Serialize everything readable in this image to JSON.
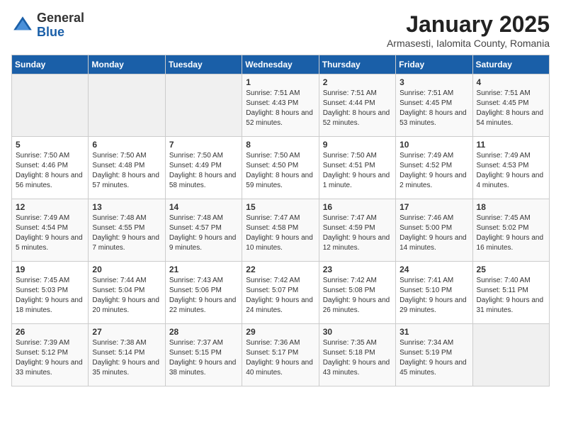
{
  "logo": {
    "general": "General",
    "blue": "Blue"
  },
  "title": "January 2025",
  "subtitle": "Armasesti, Ialomita County, Romania",
  "weekdays": [
    "Sunday",
    "Monday",
    "Tuesday",
    "Wednesday",
    "Thursday",
    "Friday",
    "Saturday"
  ],
  "weeks": [
    [
      {
        "day": "",
        "info": ""
      },
      {
        "day": "",
        "info": ""
      },
      {
        "day": "",
        "info": ""
      },
      {
        "day": "1",
        "info": "Sunrise: 7:51 AM\nSunset: 4:43 PM\nDaylight: 8 hours and 52 minutes."
      },
      {
        "day": "2",
        "info": "Sunrise: 7:51 AM\nSunset: 4:44 PM\nDaylight: 8 hours and 52 minutes."
      },
      {
        "day": "3",
        "info": "Sunrise: 7:51 AM\nSunset: 4:45 PM\nDaylight: 8 hours and 53 minutes."
      },
      {
        "day": "4",
        "info": "Sunrise: 7:51 AM\nSunset: 4:45 PM\nDaylight: 8 hours and 54 minutes."
      }
    ],
    [
      {
        "day": "5",
        "info": "Sunrise: 7:50 AM\nSunset: 4:46 PM\nDaylight: 8 hours and 56 minutes."
      },
      {
        "day": "6",
        "info": "Sunrise: 7:50 AM\nSunset: 4:48 PM\nDaylight: 8 hours and 57 minutes."
      },
      {
        "day": "7",
        "info": "Sunrise: 7:50 AM\nSunset: 4:49 PM\nDaylight: 8 hours and 58 minutes."
      },
      {
        "day": "8",
        "info": "Sunrise: 7:50 AM\nSunset: 4:50 PM\nDaylight: 8 hours and 59 minutes."
      },
      {
        "day": "9",
        "info": "Sunrise: 7:50 AM\nSunset: 4:51 PM\nDaylight: 9 hours and 1 minute."
      },
      {
        "day": "10",
        "info": "Sunrise: 7:49 AM\nSunset: 4:52 PM\nDaylight: 9 hours and 2 minutes."
      },
      {
        "day": "11",
        "info": "Sunrise: 7:49 AM\nSunset: 4:53 PM\nDaylight: 9 hours and 4 minutes."
      }
    ],
    [
      {
        "day": "12",
        "info": "Sunrise: 7:49 AM\nSunset: 4:54 PM\nDaylight: 9 hours and 5 minutes."
      },
      {
        "day": "13",
        "info": "Sunrise: 7:48 AM\nSunset: 4:55 PM\nDaylight: 9 hours and 7 minutes."
      },
      {
        "day": "14",
        "info": "Sunrise: 7:48 AM\nSunset: 4:57 PM\nDaylight: 9 hours and 9 minutes."
      },
      {
        "day": "15",
        "info": "Sunrise: 7:47 AM\nSunset: 4:58 PM\nDaylight: 9 hours and 10 minutes."
      },
      {
        "day": "16",
        "info": "Sunrise: 7:47 AM\nSunset: 4:59 PM\nDaylight: 9 hours and 12 minutes."
      },
      {
        "day": "17",
        "info": "Sunrise: 7:46 AM\nSunset: 5:00 PM\nDaylight: 9 hours and 14 minutes."
      },
      {
        "day": "18",
        "info": "Sunrise: 7:45 AM\nSunset: 5:02 PM\nDaylight: 9 hours and 16 minutes."
      }
    ],
    [
      {
        "day": "19",
        "info": "Sunrise: 7:45 AM\nSunset: 5:03 PM\nDaylight: 9 hours and 18 minutes."
      },
      {
        "day": "20",
        "info": "Sunrise: 7:44 AM\nSunset: 5:04 PM\nDaylight: 9 hours and 20 minutes."
      },
      {
        "day": "21",
        "info": "Sunrise: 7:43 AM\nSunset: 5:06 PM\nDaylight: 9 hours and 22 minutes."
      },
      {
        "day": "22",
        "info": "Sunrise: 7:42 AM\nSunset: 5:07 PM\nDaylight: 9 hours and 24 minutes."
      },
      {
        "day": "23",
        "info": "Sunrise: 7:42 AM\nSunset: 5:08 PM\nDaylight: 9 hours and 26 minutes."
      },
      {
        "day": "24",
        "info": "Sunrise: 7:41 AM\nSunset: 5:10 PM\nDaylight: 9 hours and 29 minutes."
      },
      {
        "day": "25",
        "info": "Sunrise: 7:40 AM\nSunset: 5:11 PM\nDaylight: 9 hours and 31 minutes."
      }
    ],
    [
      {
        "day": "26",
        "info": "Sunrise: 7:39 AM\nSunset: 5:12 PM\nDaylight: 9 hours and 33 minutes."
      },
      {
        "day": "27",
        "info": "Sunrise: 7:38 AM\nSunset: 5:14 PM\nDaylight: 9 hours and 35 minutes."
      },
      {
        "day": "28",
        "info": "Sunrise: 7:37 AM\nSunset: 5:15 PM\nDaylight: 9 hours and 38 minutes."
      },
      {
        "day": "29",
        "info": "Sunrise: 7:36 AM\nSunset: 5:17 PM\nDaylight: 9 hours and 40 minutes."
      },
      {
        "day": "30",
        "info": "Sunrise: 7:35 AM\nSunset: 5:18 PM\nDaylight: 9 hours and 43 minutes."
      },
      {
        "day": "31",
        "info": "Sunrise: 7:34 AM\nSunset: 5:19 PM\nDaylight: 9 hours and 45 minutes."
      },
      {
        "day": "",
        "info": ""
      }
    ]
  ]
}
